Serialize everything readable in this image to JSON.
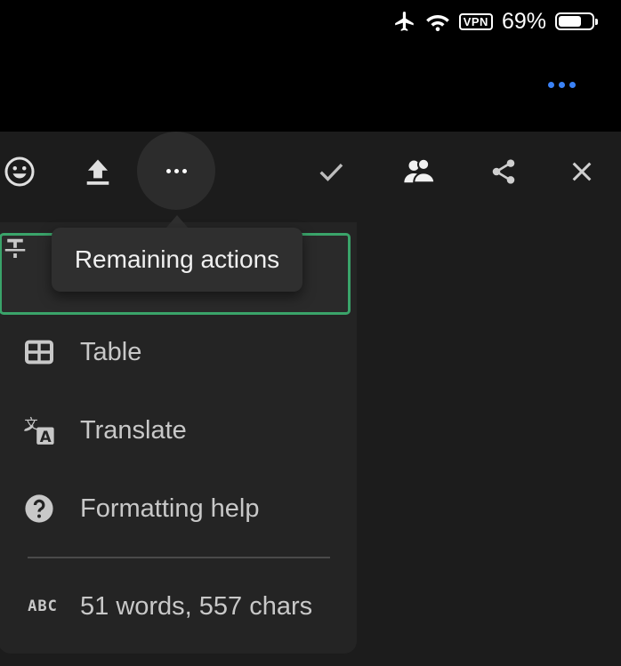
{
  "status_bar": {
    "airplane_icon": "airplane-icon",
    "wifi_icon": "wifi-icon",
    "vpn_label": "VPN",
    "battery_percent": "69%",
    "battery_level": 0.69
  },
  "header": {
    "more_icon": "more-horizontal-icon",
    "accent_color": "#3b82f6"
  },
  "toolbar": {
    "buttons": [
      {
        "name": "emoji",
        "icon": "emoji-icon"
      },
      {
        "name": "upload",
        "icon": "upload-icon"
      },
      {
        "name": "more",
        "icon": "more-icon",
        "active": true
      },
      {
        "name": "done",
        "icon": "check-icon"
      },
      {
        "name": "people",
        "icon": "people-icon"
      },
      {
        "name": "share",
        "icon": "share-icon"
      },
      {
        "name": "close",
        "icon": "close-icon"
      }
    ]
  },
  "tooltip": {
    "text": "Remaining actions"
  },
  "menu": {
    "highlight_color": "#3aa46a",
    "items": [
      {
        "icon": "strikethrough-icon",
        "label": ""
      },
      {
        "icon": "table-icon",
        "label": "Table"
      },
      {
        "icon": "translate-icon",
        "label": "Translate"
      },
      {
        "icon": "help-icon",
        "label": "Formatting help"
      }
    ],
    "stats": {
      "icon_text": "ABC",
      "label": "51 words, 557 chars"
    }
  }
}
